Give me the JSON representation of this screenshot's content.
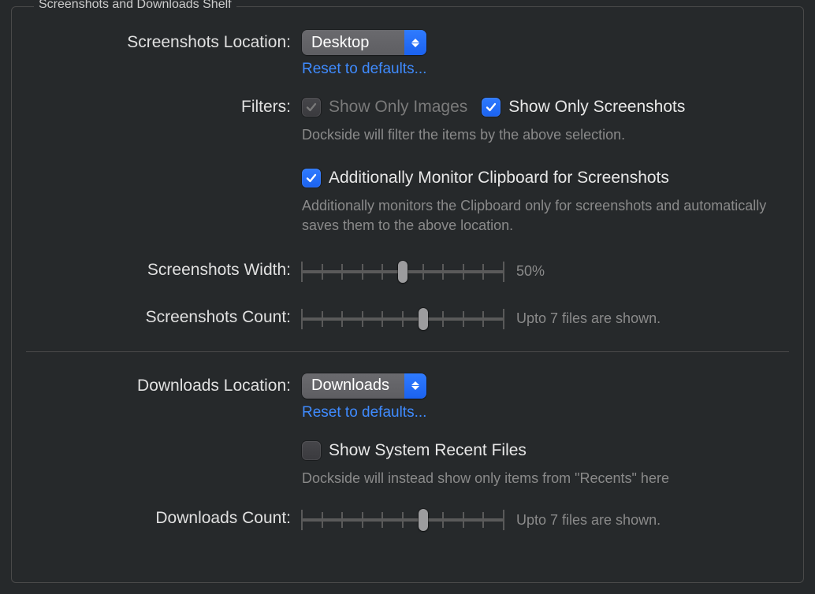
{
  "group": {
    "title": "Screenshots and Downloads Shelf"
  },
  "screenshots": {
    "location_label": "Screenshots Location:",
    "location_value": "Desktop",
    "reset_link": "Reset to defaults...",
    "filters_label": "Filters:",
    "filter_images": {
      "label": "Show Only Images",
      "checked": true,
      "enabled": false
    },
    "filter_screenshots": {
      "label": "Show Only Screenshots",
      "checked": true,
      "enabled": true
    },
    "filters_hint": "Dockside will filter the items by the above selection.",
    "clipboard": {
      "label": "Additionally Monitor Clipboard for Screenshots",
      "checked": true
    },
    "clipboard_hint": "Additionally monitors the Clipboard only for screenshots and automatically saves them to the above location.",
    "width_label": "Screenshots Width:",
    "width_value_text": "50%",
    "width_value_pct": 50,
    "count_label": "Screenshots Count:",
    "count_value_text": "Upto 7 files are shown.",
    "count_value_pct": 60
  },
  "downloads": {
    "location_label": "Downloads Location:",
    "location_value": "Downloads",
    "reset_link": "Reset to defaults...",
    "recent": {
      "label": "Show System Recent Files",
      "checked": false
    },
    "recent_hint": "Dockside will instead show only items from \"Recents\" here",
    "count_label": "Downloads Count:",
    "count_value_text": "Upto 7 files are shown.",
    "count_value_pct": 60
  }
}
